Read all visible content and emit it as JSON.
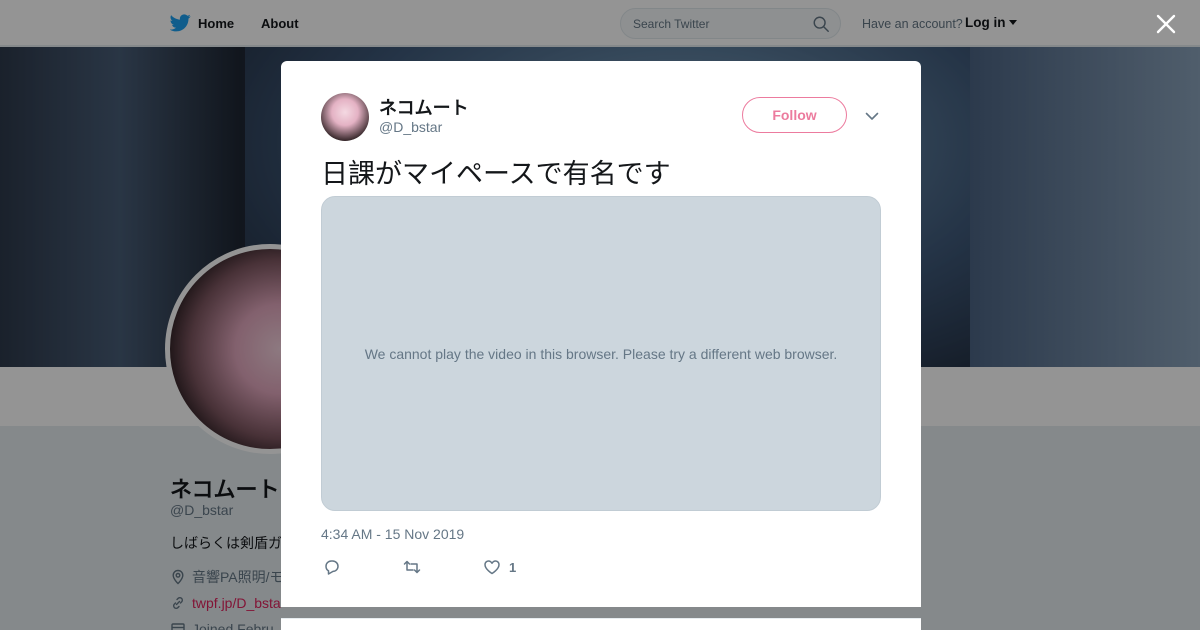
{
  "nav": {
    "home_label": "Home",
    "about_label": "About",
    "search_placeholder": "Search Twitter",
    "have_account": "Have an account?",
    "login_label": "Log in"
  },
  "profile": {
    "name": "ネコムート",
    "handle": "@D_bstar",
    "bio": "しばらくは剣盾ガ",
    "location": "音響PA照明/モ",
    "url": "twpf.jp/D_bsta",
    "joined": "Joined Febru"
  },
  "tweet": {
    "author_name": "ネコムート",
    "author_handle": "@D_bstar",
    "follow_label": "Follow",
    "text": "日課がマイペースで有名です",
    "video_message": "We cannot play the video in this browser. Please try a different web browser.",
    "timestamp": "4:34 AM - 15 Nov 2019",
    "like_count": "1"
  },
  "colors": {
    "brand_blue": "#1da1f2",
    "accent_pink": "#e0245e",
    "text_primary": "#14171a",
    "text_secondary": "#657786"
  },
  "icons": [
    "twitter-bird-icon",
    "search-icon",
    "close-icon",
    "chevron-down-icon",
    "reply-icon",
    "retweet-icon",
    "like-icon",
    "location-icon",
    "link-icon",
    "calendar-icon"
  ]
}
